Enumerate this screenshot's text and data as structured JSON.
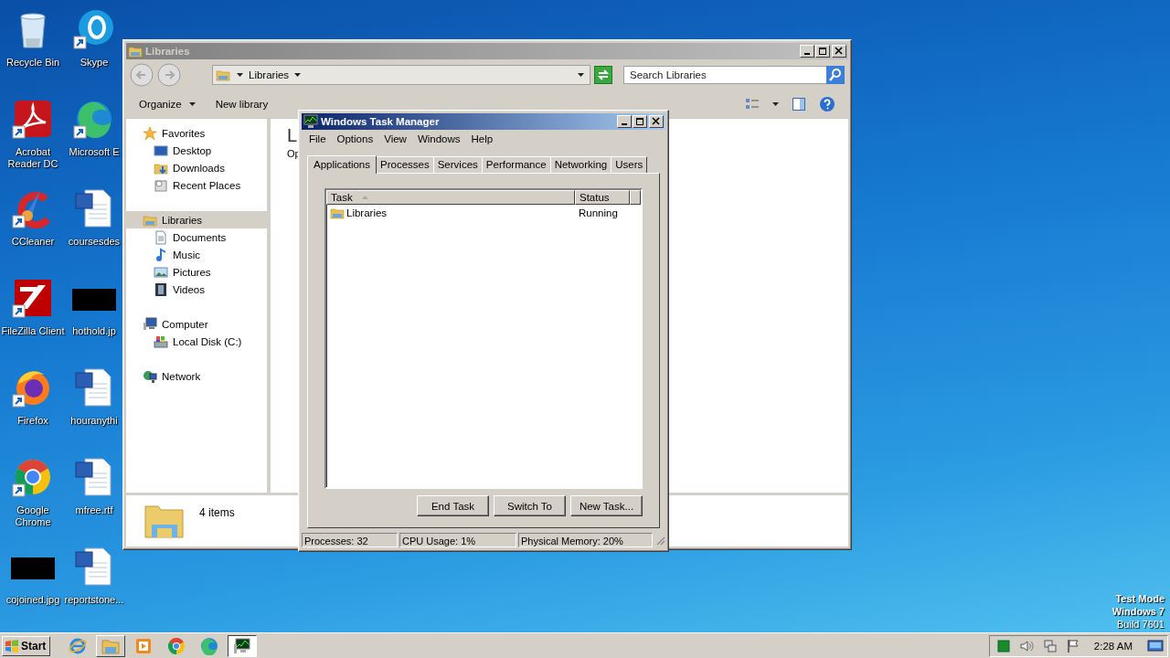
{
  "desktop": {
    "icons": [
      {
        "label": "Recycle Bin",
        "kind": "recycle",
        "shortcut": false
      },
      {
        "label": "Skype",
        "kind": "skype",
        "shortcut": true
      },
      {
        "label": "Acrobat Reader DC",
        "kind": "acrobat",
        "shortcut": true
      },
      {
        "label": "Microsoft E",
        "kind": "edge",
        "shortcut": true
      },
      {
        "label": "CCleaner",
        "kind": "ccleaner",
        "shortcut": true
      },
      {
        "label": "coursesdes",
        "kind": "word",
        "shortcut": false
      },
      {
        "label": "FileZilla Client",
        "kind": "filezilla",
        "shortcut": true
      },
      {
        "label": "hothold.jp",
        "kind": "image",
        "shortcut": false
      },
      {
        "label": "Firefox",
        "kind": "firefox",
        "shortcut": true
      },
      {
        "label": "houranythi",
        "kind": "word",
        "shortcut": false
      },
      {
        "label": "Google Chrome",
        "kind": "chrome",
        "shortcut": true
      },
      {
        "label": "mfree.rtf",
        "kind": "word",
        "shortcut": false
      },
      {
        "label": "cojoined.jpg",
        "kind": "image",
        "shortcut": false
      },
      {
        "label": "reportstone...",
        "kind": "word",
        "shortcut": false
      }
    ],
    "notice": [
      {
        "text": "Test Mode",
        "bold": true
      },
      {
        "text": "Windows 7",
        "bold": true
      },
      {
        "text": "Build 7601",
        "bold": false
      }
    ]
  },
  "explorer": {
    "title": "Libraries",
    "address": "Libraries",
    "search": {
      "placeholder": "Search Libraries"
    },
    "toolbar": [
      {
        "label": "Organize",
        "menu": true
      },
      {
        "label": "New library",
        "menu": false
      }
    ],
    "nav": [
      {
        "label": "Favorites",
        "kind": "star",
        "selected": false,
        "children": [
          {
            "label": "Desktop",
            "kind": "desktop",
            "selected": false
          },
          {
            "label": "Downloads",
            "kind": "downloads",
            "selected": false
          },
          {
            "label": "Recent Places",
            "kind": "recent",
            "selected": false
          }
        ]
      },
      {
        "label": "Libraries",
        "kind": "library",
        "selected": true,
        "children": [
          {
            "label": "Documents",
            "kind": "documents",
            "selected": false
          },
          {
            "label": "Music",
            "kind": "music",
            "selected": false
          },
          {
            "label": "Pictures",
            "kind": "pictures",
            "selected": false
          },
          {
            "label": "Videos",
            "kind": "videos",
            "selected": false
          }
        ]
      },
      {
        "label": "Computer",
        "kind": "computer",
        "selected": false,
        "children": [
          {
            "label": "Local Disk (C:)",
            "kind": "disk",
            "selected": false
          }
        ]
      },
      {
        "label": "Network",
        "kind": "network",
        "selected": false
      }
    ],
    "content": {
      "heading": "L",
      "text": "Op"
    },
    "details": {
      "count": "4 items"
    }
  },
  "task_manager": {
    "title": "Windows Task Manager",
    "menu": [
      "File",
      "Options",
      "View",
      "Windows",
      "Help"
    ],
    "tabs": [
      {
        "label": "Applications",
        "selected": true
      },
      {
        "label": "Processes",
        "selected": false
      },
      {
        "label": "Services",
        "selected": false
      },
      {
        "label": "Performance",
        "selected": false
      },
      {
        "label": "Networking",
        "selected": false
      },
      {
        "label": "Users",
        "selected": false
      }
    ],
    "columns": [
      {
        "label": "Task",
        "sorted": true
      },
      {
        "label": "Status",
        "sorted": false
      }
    ],
    "rows": [
      {
        "task": "Libraries",
        "status": "Running",
        "selected": false
      }
    ],
    "buttons": [
      "End Task",
      "Switch To",
      "New Task..."
    ],
    "status_bar": [
      "Processes: 32",
      "CPU Usage: 1%",
      "Physical Memory: 20%"
    ]
  },
  "taskbar": {
    "start": "Start",
    "apps": [
      {
        "kind": "ie",
        "open": false,
        "selected": false
      },
      {
        "kind": "explorer",
        "open": true,
        "selected": false
      },
      {
        "kind": "media",
        "open": false,
        "selected": false
      },
      {
        "kind": "chrome",
        "open": false,
        "selected": false
      },
      {
        "kind": "edge",
        "open": false,
        "selected": false
      },
      {
        "kind": "taskmgr",
        "open": true,
        "selected": true
      }
    ],
    "clock": "2:28 AM"
  }
}
